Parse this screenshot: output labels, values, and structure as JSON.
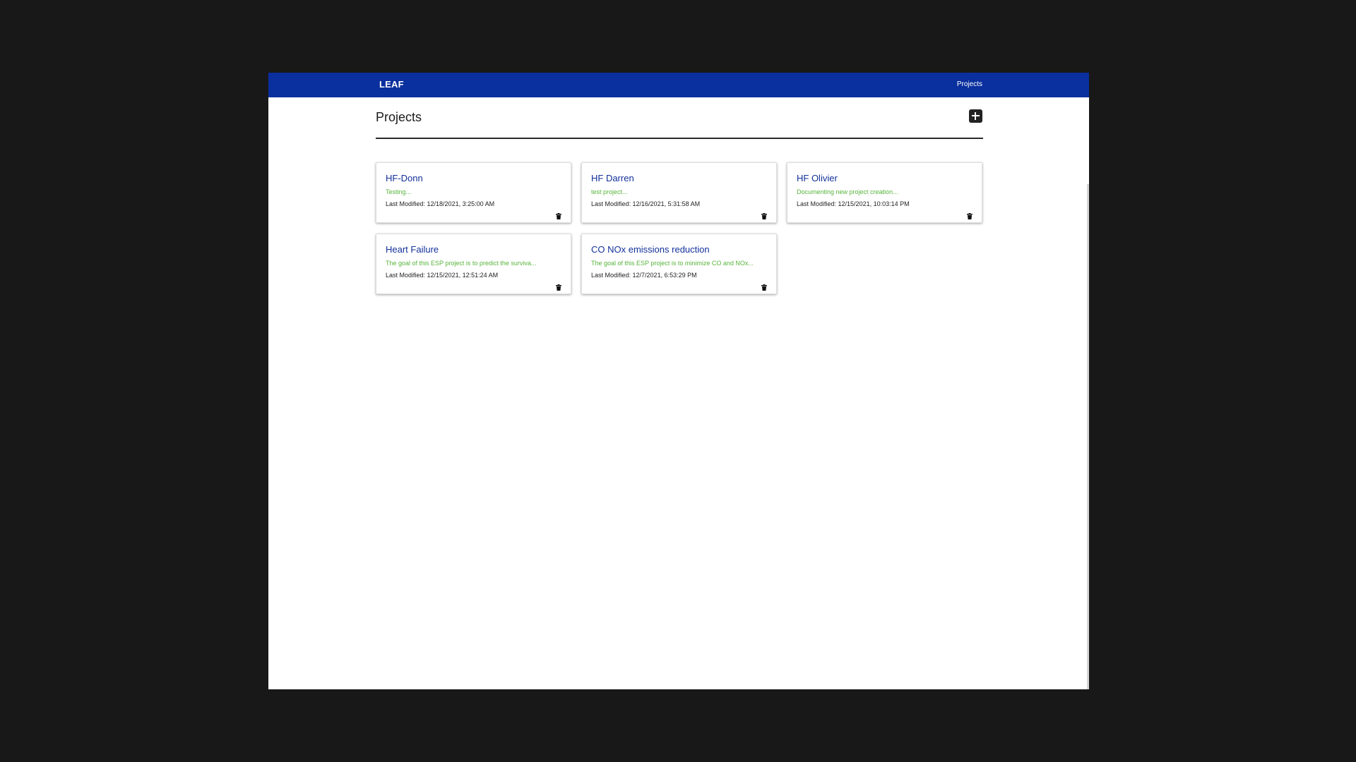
{
  "navbar": {
    "brand": "LEAF",
    "links": [
      {
        "label": "Projects"
      }
    ]
  },
  "page": {
    "title": "Projects",
    "add_icon": "plus-icon"
  },
  "projects": [
    {
      "name": "HF-Donn",
      "description": "Testing...",
      "last_modified": "Last Modified: 12/18/2021, 3:25:00 AM"
    },
    {
      "name": "HF Darren",
      "description": "test project...",
      "last_modified": "Last Modified: 12/16/2021, 5:31:58 AM"
    },
    {
      "name": "HF Olivier",
      "description": "Documenting new project creation...",
      "last_modified": "Last Modified: 12/15/2021, 10:03:14 PM"
    },
    {
      "name": "Heart Failure",
      "description": "The goal of this ESP project is to predict the surviva...",
      "last_modified": "Last Modified: 12/15/2021, 12:51:24 AM"
    },
    {
      "name": "CO NOx emissions reduction",
      "description": "The goal of this ESP project is to minimize CO and NOx...",
      "last_modified": "Last Modified: 12/7/2021, 6:53:29 PM"
    }
  ],
  "card_actions": {
    "delete_icon": "trash-icon"
  },
  "colors": {
    "navbar": "#0a2f9e",
    "project_title": "#12319a",
    "description": "#57b43a",
    "background": "#181818"
  }
}
